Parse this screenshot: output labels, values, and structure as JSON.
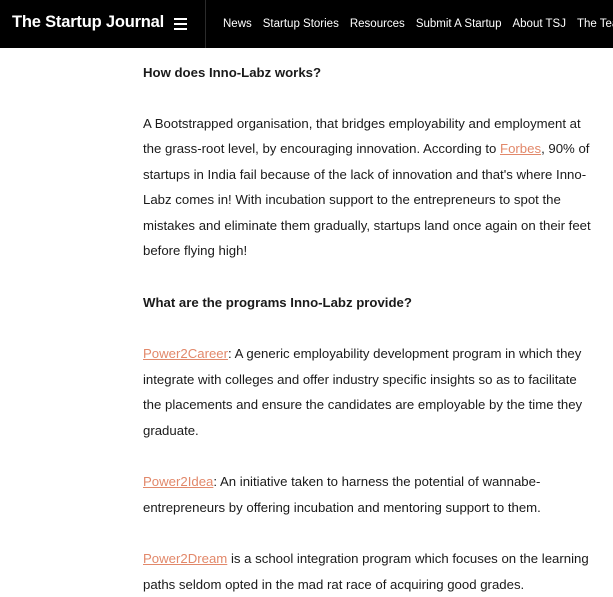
{
  "header": {
    "brand": "The Startup Journal",
    "nav": [
      "News",
      "Startup Stories",
      "Resources",
      "Submit A Startup",
      "About TSJ",
      "The Team"
    ]
  },
  "article": {
    "heading1": "How does Inno-Labz works?",
    "p1_before": "A Bootstrapped organisation, that bridges employability and employment at the grass-root level, by encouraging innovation. According to ",
    "p1_link": "Forbes",
    "p1_after": ", 90% of startups in India fail because of the lack of innovation and that's where Inno-Labz comes in! With incubation support to the entrepreneurs to spot the mistakes and eliminate them gradually, startups land once again on their feet before flying high!",
    "heading2": "What are the programs Inno-Labz provide?",
    "p2_link": "Power2Career",
    "p2_text": ": A generic employability development program in which they integrate with colleges and offer industry specific insights so as to facilitate the placements and ensure the candidates are employable by the time they graduate.",
    "p3_link": "Power2Idea",
    "p3_text": ": An initiative taken to harness the potential of wannabe-entrepreneurs by offering incubation and mentoring support to them.",
    "p4_link": "Power2Dream",
    "p4_text": " is a school integration program which focuses on the learning paths seldom opted in the mad rat race of acquiring good grades."
  },
  "colors": {
    "topbar": "#000000",
    "link": "#e2886a"
  }
}
